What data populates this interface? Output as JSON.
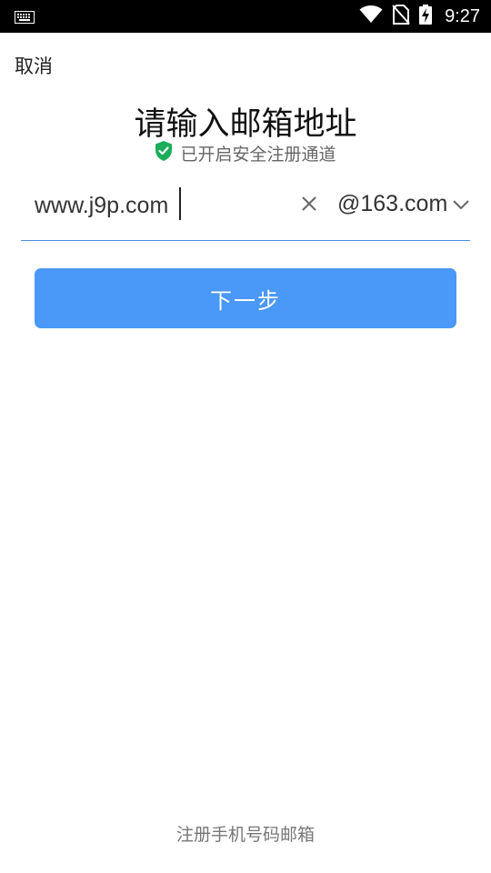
{
  "status_bar": {
    "time": "9:27",
    "icons": [
      "keyboard-icon",
      "wifi-icon",
      "no-sim-icon",
      "battery-charging-icon"
    ]
  },
  "header": {
    "cancel_label": "取消",
    "title": "请输入邮箱地址",
    "secure_text": "已开启安全注册通道"
  },
  "form": {
    "email_value": "www.j9p.com",
    "domain": "@163.com",
    "next_label": "下一步"
  },
  "footer": {
    "link_label": "注册手机号码邮箱"
  },
  "colors": {
    "accent": "#4a98f7",
    "shield": "#1aad5a",
    "underline": "#4a90e2"
  }
}
